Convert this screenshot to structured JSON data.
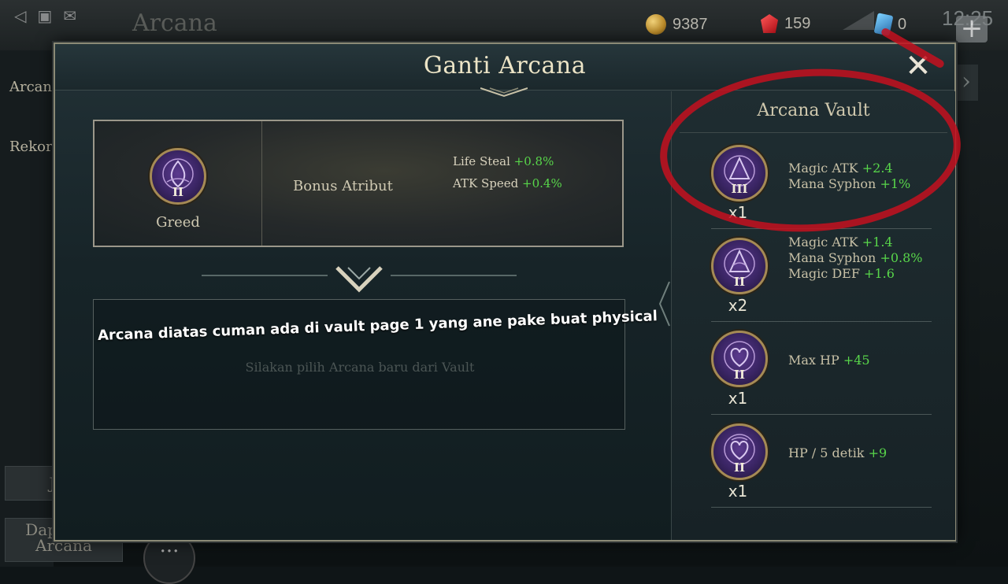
{
  "background": {
    "title": "Arcana",
    "gold": "9387",
    "gems": "159",
    "tickets": "0",
    "clock": "12:25",
    "side_tabs": [
      "Arcan",
      "Rekor"
    ],
    "buttons": [
      "Jual",
      "Dapatkan Arcana"
    ]
  },
  "modal": {
    "title": "Ganti Arcana",
    "current": {
      "name": "Greed",
      "tier": "II",
      "bonus_label": "Bonus Atribut",
      "stats": [
        {
          "name": "Life Steal",
          "value": "+0.8%"
        },
        {
          "name": "ATK Speed",
          "value": "+0.4%"
        }
      ]
    },
    "empty_hint": "Silakan pilih Arcana baru dari Vault",
    "overlay_note": "Arcana diatas cuman ada di vault page 1 yang ane pake buat physical",
    "vault": {
      "title": "Arcana Vault",
      "items": [
        {
          "tier": "III",
          "qty": "x1",
          "stats": [
            {
              "name": "Magic ATK",
              "value": "+2.4"
            },
            {
              "name": "Mana Syphon",
              "value": "+1%"
            }
          ]
        },
        {
          "tier": "II",
          "qty": "x2",
          "stats": [
            {
              "name": "Magic ATK",
              "value": "+1.4"
            },
            {
              "name": "Mana Syphon",
              "value": "+0.8%"
            },
            {
              "name": "Magic DEF",
              "value": "+1.6"
            }
          ]
        },
        {
          "tier": "II",
          "qty": "x1",
          "stats": [
            {
              "name": "Max HP",
              "value": "+45"
            }
          ]
        },
        {
          "tier": "II",
          "qty": "x1",
          "stats": [
            {
              "name": "HP / 5 detik",
              "value": "+9"
            }
          ]
        }
      ]
    }
  },
  "colors": {
    "positive": "#58d64a",
    "accent_gold": "#a58a55",
    "annotation_red": "#c4101e"
  }
}
